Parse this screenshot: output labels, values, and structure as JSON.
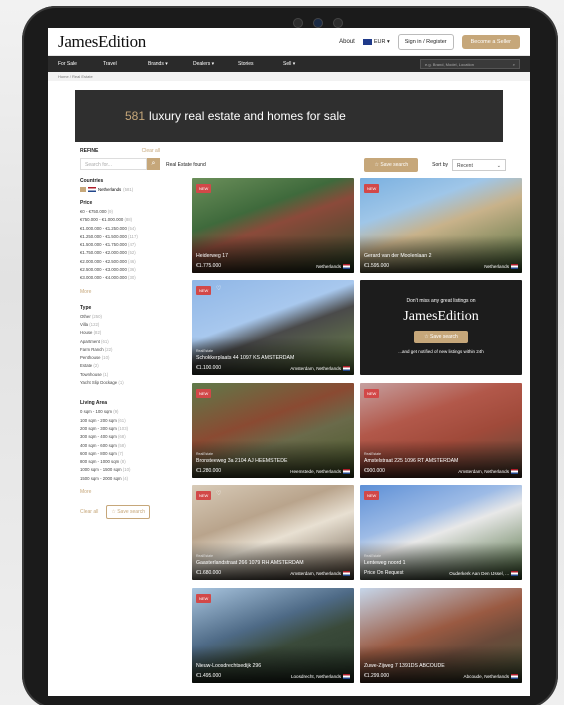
{
  "header": {
    "logo": "JamesEdition",
    "about": "About",
    "currency": "EUR ▾",
    "signin": "Sign in / Register",
    "seller": "Become a Seller"
  },
  "nav": {
    "items": [
      "For Sale",
      "Travel",
      "Brands ▾",
      "Dealers ▾",
      "Stories",
      "Sell ▾"
    ],
    "search_placeholder": "e.g. Brand, Model, Location"
  },
  "breadcrumb": "Home  /  Real Estate",
  "hero": {
    "count": "581",
    "text": "luxury real estate and homes for sale"
  },
  "sidebar": {
    "refine": "REFINE",
    "clear_all": "Clear all",
    "search_placeholder": "Search for...",
    "countries_title": "Countries",
    "country": "Netherlands",
    "country_count": "(581)",
    "price_title": "Price",
    "price_rows": [
      {
        "label": "€0 - €750.000",
        "count": "(9)"
      },
      {
        "label": "€750.000 - €1.000.000",
        "count": "(88)"
      },
      {
        "label": "€1.000.000 - €1.250.000",
        "count": "(54)"
      },
      {
        "label": "€1.250.000 - €1.500.000",
        "count": "(117)"
      },
      {
        "label": "€1.500.000 - €1.750.000",
        "count": "(47)"
      },
      {
        "label": "€1.750.000 - €2.000.000",
        "count": "(52)"
      },
      {
        "label": "€2.000.000 - €2.500.000",
        "count": "(46)"
      },
      {
        "label": "€2.500.000 - €3.000.000",
        "count": "(36)"
      },
      {
        "label": "€3.000.000 - €4.000.000",
        "count": "(30)"
      }
    ],
    "more": "More",
    "type_title": "Type",
    "type_rows": [
      {
        "label": "Other",
        "count": "(250)"
      },
      {
        "label": "Villa",
        "count": "(122)"
      },
      {
        "label": "House",
        "count": "(82)"
      },
      {
        "label": "Apartment",
        "count": "(61)"
      },
      {
        "label": "Farm Ranch",
        "count": "(22)"
      },
      {
        "label": "Penthouse",
        "count": "(10)"
      },
      {
        "label": "Estate",
        "count": "(2)"
      },
      {
        "label": "Townhouse",
        "count": "(1)"
      },
      {
        "label": "Yacht Slip Dockage",
        "count": "(1)"
      }
    ],
    "area_title": "Living Area",
    "area_rows": [
      {
        "label": "0 sqm - 100 sqm",
        "count": "(9)"
      },
      {
        "label": "100 sqm - 200 sqm",
        "count": "(61)"
      },
      {
        "label": "200 sqm - 300 sqm",
        "count": "(103)"
      },
      {
        "label": "300 sqm - 400 sqm",
        "count": "(68)"
      },
      {
        "label": "400 sqm - 600 sqm",
        "count": "(58)"
      },
      {
        "label": "600 sqm - 800 sqm",
        "count": "(7)"
      },
      {
        "label": "800 sqm - 1000 sqm",
        "count": "(8)"
      },
      {
        "label": "1000 sqm - 1500 sqm",
        "count": "(10)"
      },
      {
        "label": "1500 sqm - 2000 sqm",
        "count": "(4)"
      }
    ],
    "more2": "More",
    "foot_clear": "Clear all",
    "foot_save": "☆ Save search"
  },
  "results": {
    "found": "Real Estate found",
    "save": "☆ Save search",
    "sort_label": "Sort by",
    "sort_value": "Recent"
  },
  "cards": [
    {
      "new": "NEW",
      "heart": "",
      "tag": "",
      "title": "Heiderweg 17",
      "price": "€1.775.000",
      "loc": "Netherlands",
      "bg": "linear-gradient(160deg,#6b8f5a 0%,#3f6a3c 35%,#8b4a3a 50%,#2e4a2a 100%)"
    },
    {
      "new": "NEW",
      "heart": "",
      "tag": "",
      "title": "Gerard van der Moolenlaan 2",
      "price": "€1.595.000",
      "loc": "Netherlands",
      "bg": "linear-gradient(160deg,#7ab0e0 0%,#9fc6e8 30%,#c8b28a 50%,#4b6b3a 100%)"
    },
    {
      "new": "NEW",
      "heart": "♡",
      "tag": "RealEstate",
      "title": "Schokkerplaats 44 1097 KS AMSTERDAM",
      "price": "€1.100.000",
      "loc": "Amsterdam, Netherlands",
      "bg": "linear-gradient(160deg,#8fb6e6 0%,#a8c8ee 40%,#4a4a4a 55%,#6f8a4a 100%)"
    },
    {
      "new": "NEW",
      "heart": "",
      "tag": "RealEstate",
      "title": "Bronsteeweg 3a 2104 AJ HEEMSTEDE",
      "price": "€1.280.000",
      "loc": "Heemstede, Netherlands",
      "bg": "linear-gradient(160deg,#5f7a4a 0%,#8a4a32 40%,#6a6a4a 60%,#4a5a2a 100%)"
    },
    {
      "new": "NEW",
      "heart": "",
      "tag": "RealEstate",
      "title": "Amstelstraat 225 1096 RT AMSTERDAM",
      "price": "€900.000",
      "loc": "Amsterdam, Netherlands",
      "bg": "linear-gradient(160deg,#c6a0a0 0%,#b2584a 35%,#a04a3a 60%,#5a4a3a 100%)"
    },
    {
      "new": "NEW",
      "heart": "♡",
      "tag": "RealEstate",
      "title": "Gaasterlandstraat 266 1079 RH AMSTERDAM",
      "price": "€1.680.000",
      "loc": "Amsterdam, Netherlands",
      "bg": "linear-gradient(160deg,#d8cbb8 0%,#b9a48c 35%,#e8e0d2 55%,#6a5a48 100%)"
    },
    {
      "new": "NEW",
      "heart": "",
      "tag": "RealEstate",
      "title": "Lenteweg noord 1",
      "price": "Price On Request",
      "loc": "Ouderkerk Aan Den IJssel, ...",
      "bg": "linear-gradient(160deg,#5d8fd6 0%,#9dbbe6 35%,#e8e8e8 50%,#4a6a3a 100%)"
    },
    {
      "new": "NEW",
      "heart": "",
      "tag": "",
      "title": "Nieuw-Loosdrechtsedijk 296",
      "price": "€1.495.000",
      "loc": "Loosdrecht, Netherlands",
      "bg": "linear-gradient(160deg,#aac6e0 0%,#4e6a86 40%,#3a4a3a 60%,#2a3a2a 100%)"
    },
    {
      "new": "",
      "heart": "",
      "tag": "",
      "title": "Zuwe-Zijweg 7 1391DS ABCOUDE",
      "price": "€1.299.000",
      "loc": "Abcoude, Netherlands",
      "bg": "linear-gradient(160deg,#c6d6ea 0%,#9a5a42 45%,#6a4a3a 65%,#4a5a3a 100%)"
    }
  ],
  "promo": {
    "line1": "Don't miss any great listings on",
    "logo": "JamesEdition",
    "button": "☆ Save search",
    "line2": "...and get notified of new listings within 24h"
  }
}
